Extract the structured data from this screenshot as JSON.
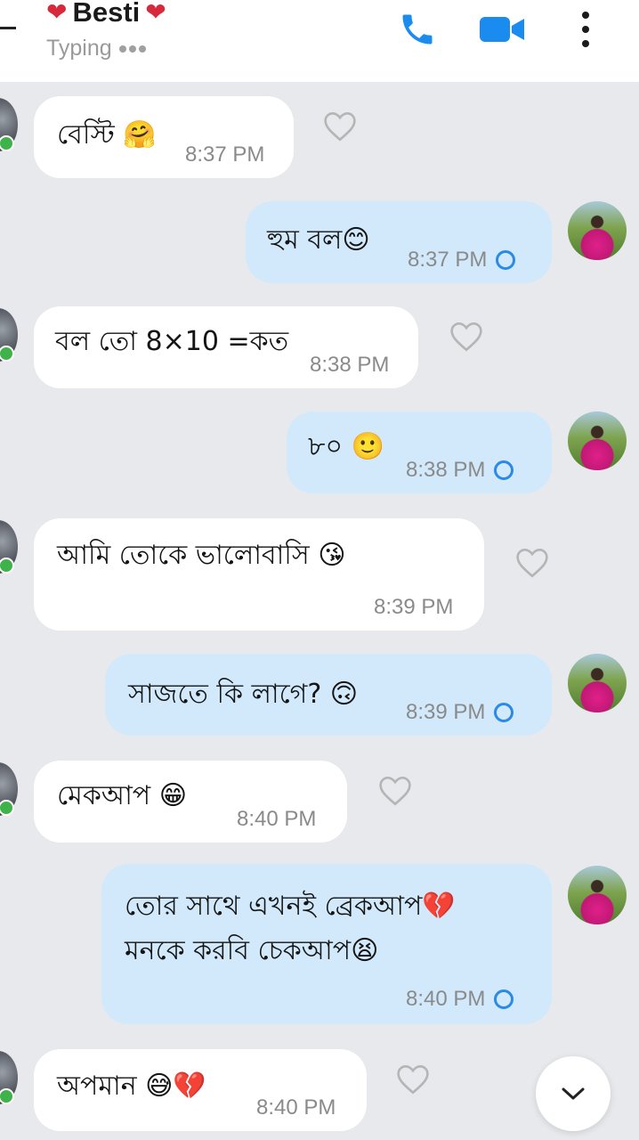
{
  "header": {
    "title": "Besti",
    "status": "Typing",
    "icons": {
      "back": "back-arrow-icon",
      "call": "phone-icon",
      "video": "video-camera-icon",
      "more": "more-vertical-icon"
    }
  },
  "colors": {
    "accent": "#2a8ae6",
    "incoming_bubble": "#ffffff",
    "outgoing_bubble": "#d1e9fb",
    "background": "#e8e9ec",
    "online": "#3fb24a"
  },
  "messages": [
    {
      "direction": "in",
      "text": "বেস্টি 🤗",
      "time": "8:37 PM"
    },
    {
      "direction": "out",
      "text": "হুম বল😊",
      "time": "8:37 PM"
    },
    {
      "direction": "in",
      "text": "বল তো 8×10 =কত",
      "time": "8:38 PM"
    },
    {
      "direction": "out",
      "text": "৮০ 🙂",
      "time": "8:38 PM"
    },
    {
      "direction": "in",
      "text": "আমি তোকে ভালোবাসি 😘",
      "time": "8:39 PM"
    },
    {
      "direction": "out",
      "text": "সাজতে কি লাগে? 🙃",
      "time": "8:39 PM"
    },
    {
      "direction": "in",
      "text": "মেকআপ 😁",
      "time": "8:40 PM"
    },
    {
      "direction": "out",
      "text_line1": "তোর সাথে এখনই ব্রেকআপ💔",
      "text_line2": "মনকে করবি চেকআপ😫",
      "time": "8:40 PM"
    },
    {
      "direction": "in",
      "text": "অপমান 😅💔",
      "time": "8:40 PM"
    }
  ],
  "scroll_down_icon": "chevron-down-icon"
}
